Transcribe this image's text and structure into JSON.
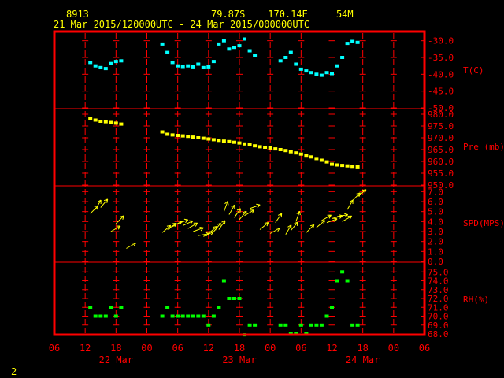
{
  "header": {
    "station": "8913",
    "location": "79.87S    170.14E     54M",
    "time_range": "21 Mar 2015/120000UTC - 24 Mar 2015/000000UTC"
  },
  "footer": {
    "page_number": "2"
  },
  "colors": {
    "frame": "#ff0000",
    "grid": "#ff0000",
    "axis_text": "#ff0000",
    "header_text": "#ffff00",
    "temperature": "#00ffff",
    "pressure": "#ffff00",
    "wind": "#ffff00",
    "humidity": "#00ff00"
  },
  "chart_data": {
    "type": "scatter",
    "x_axis": {
      "hour_ticks": [
        "06",
        "12",
        "18",
        "00",
        "06",
        "12",
        "18",
        "00",
        "06",
        "12",
        "18",
        "00",
        "06"
      ],
      "day_labels": [
        {
          "label": "22 Mar",
          "hours": 18
        },
        {
          "label": "23 Mar",
          "hours": 42
        },
        {
          "label": "24 Mar",
          "hours": 66
        }
      ],
      "xlim_hours_from_21Mar_00UTC": [
        6,
        78
      ],
      "vertical_dashed_grid": true
    },
    "panels": [
      {
        "name": "T(C)",
        "series_name": "T(C)",
        "ylim": [
          -50,
          -27.5
        ],
        "y_ticks": [
          -30,
          -35,
          -40,
          -45,
          -50
        ],
        "y_tick_labels": [
          "-30.0",
          "-35.0",
          "-40.0",
          "-45.0",
          "-50.0"
        ],
        "x_hours": [
          13,
          14,
          15,
          16,
          17,
          18,
          19,
          27,
          28,
          29,
          30,
          31,
          32,
          33,
          34,
          35,
          36,
          37,
          38,
          39,
          40,
          41,
          42,
          43,
          44,
          45,
          50,
          51,
          52,
          53,
          54,
          55,
          56,
          57,
          58,
          59,
          60,
          61,
          62,
          63,
          64,
          65
        ],
        "values": [
          -36.5,
          -37.5,
          -38.0,
          -38.3,
          -36.8,
          -36.2,
          -36.0,
          -31.0,
          -33.5,
          -36.5,
          -37.5,
          -37.7,
          -37.5,
          -37.8,
          -37.0,
          -38.0,
          -37.8,
          -36.2,
          -31.0,
          -30.0,
          -32.5,
          -32.0,
          -31.5,
          -29.5,
          -33.0,
          -34.5,
          -36.0,
          -35.0,
          -33.5,
          -37.0,
          -38.5,
          -39.0,
          -39.5,
          -40.0,
          -40.3,
          -39.5,
          -39.8,
          -37.5,
          -35.0,
          -30.8,
          -30.2,
          -30.5
        ]
      },
      {
        "name": "Pre (mb)",
        "series_name": "Pre (mb)",
        "ylim": [
          950,
          982
        ],
        "y_ticks": [
          980,
          975,
          970,
          965,
          960,
          955,
          950
        ],
        "y_tick_labels": [
          "980.0",
          "975.0",
          "970.0",
          "965.0",
          "960.0",
          "955.0",
          "950.0"
        ],
        "x_hours": [
          13,
          14,
          15,
          16,
          17,
          18,
          19,
          27,
          28,
          29,
          30,
          31,
          32,
          33,
          34,
          35,
          36,
          37,
          38,
          39,
          40,
          41,
          42,
          43,
          44,
          45,
          46,
          47,
          48,
          49,
          50,
          51,
          52,
          53,
          54,
          55,
          56,
          57,
          58,
          59,
          60,
          61,
          62,
          63,
          64,
          65
        ],
        "values": [
          978.0,
          977.5,
          977.0,
          976.8,
          976.5,
          976.2,
          975.8,
          972.5,
          971.5,
          971.2,
          971.0,
          970.8,
          970.6,
          970.3,
          970.0,
          969.8,
          969.5,
          969.2,
          968.9,
          968.6,
          968.4,
          968.1,
          967.8,
          967.4,
          967.0,
          966.6,
          966.2,
          966.0,
          965.7,
          965.3,
          965.0,
          964.6,
          964.1,
          963.6,
          963.1,
          962.6,
          961.9,
          961.2,
          960.5,
          959.8,
          958.8,
          958.5,
          958.3,
          958.1,
          957.9,
          957.7
        ]
      },
      {
        "name": "SPD(MPS)",
        "series_name": "SPD(MPS)",
        "ylim": [
          0,
          7.5
        ],
        "y_ticks": [
          7,
          6,
          5,
          4,
          3,
          2,
          1,
          0
        ],
        "y_tick_labels": [
          "7.0",
          "6.0",
          "5.0",
          "4.0",
          "3.0",
          "2.0",
          "1.0",
          "0.0"
        ],
        "x_hours": [
          13,
          14,
          15,
          17,
          18,
          20,
          27,
          28,
          29,
          30,
          31,
          32,
          33,
          34,
          35,
          36,
          37,
          38,
          39,
          40,
          41,
          42,
          43,
          44,
          46,
          48,
          49,
          51,
          52,
          53,
          55,
          57,
          58,
          59,
          60,
          61,
          62,
          63,
          64,
          65
        ],
        "values": [
          4.8,
          5.2,
          5.4,
          3.0,
          3.8,
          1.3,
          2.9,
          3.2,
          3.5,
          3.8,
          3.6,
          3.3,
          3.0,
          2.6,
          2.5,
          2.8,
          3.0,
          3.2,
          5.0,
          4.7,
          4.4,
          4.2,
          4.6,
          5.3,
          3.2,
          2.8,
          3.9,
          2.7,
          3.1,
          4.0,
          2.9,
          3.4,
          4.1,
          3.9,
          4.3,
          4.5,
          4.0,
          5.2,
          6.1,
          6.5
        ],
        "direction_from_deg": [
          225,
          210,
          220,
          240,
          225,
          240,
          230,
          235,
          240,
          250,
          245,
          240,
          250,
          260,
          245,
          230,
          220,
          215,
          200,
          210,
          215,
          220,
          240,
          250,
          230,
          240,
          215,
          210,
          220,
          200,
          225,
          230,
          240,
          250,
          255,
          260,
          240,
          210,
          225,
          230
        ]
      },
      {
        "name": "RH(%)",
        "series_name": "RH(%)",
        "ylim": [
          68,
          76
        ],
        "y_ticks": [
          75,
          74,
          73,
          72,
          71,
          70,
          69,
          68
        ],
        "y_tick_labels": [
          "75.0",
          "74.0",
          "73.0",
          "72.0",
          "71.0",
          "70.0",
          "69.0",
          "68.0"
        ],
        "x_hours": [
          13,
          14,
          15,
          16,
          17,
          18,
          19,
          27,
          28,
          29,
          30,
          31,
          32,
          33,
          34,
          35,
          36,
          37,
          38,
          39,
          40,
          41,
          42,
          43,
          44,
          45,
          50,
          51,
          52,
          53,
          54,
          55,
          56,
          57,
          58,
          59,
          60,
          61,
          62,
          63,
          64,
          65
        ],
        "values": [
          71.0,
          70.0,
          70.0,
          70.0,
          71.0,
          70.0,
          71.0,
          70.0,
          71.0,
          70.0,
          70.0,
          70.0,
          70.0,
          70.0,
          70.0,
          70.0,
          69.0,
          70.0,
          71.0,
          74.0,
          72.0,
          72.0,
          72.0,
          67.9,
          69.0,
          69.0,
          69.0,
          69.0,
          68.0,
          68.0,
          69.0,
          68.0,
          69.0,
          69.0,
          69.0,
          70.0,
          71.0,
          74.0,
          75.0,
          74.0,
          69.0,
          69.0
        ]
      }
    ]
  }
}
